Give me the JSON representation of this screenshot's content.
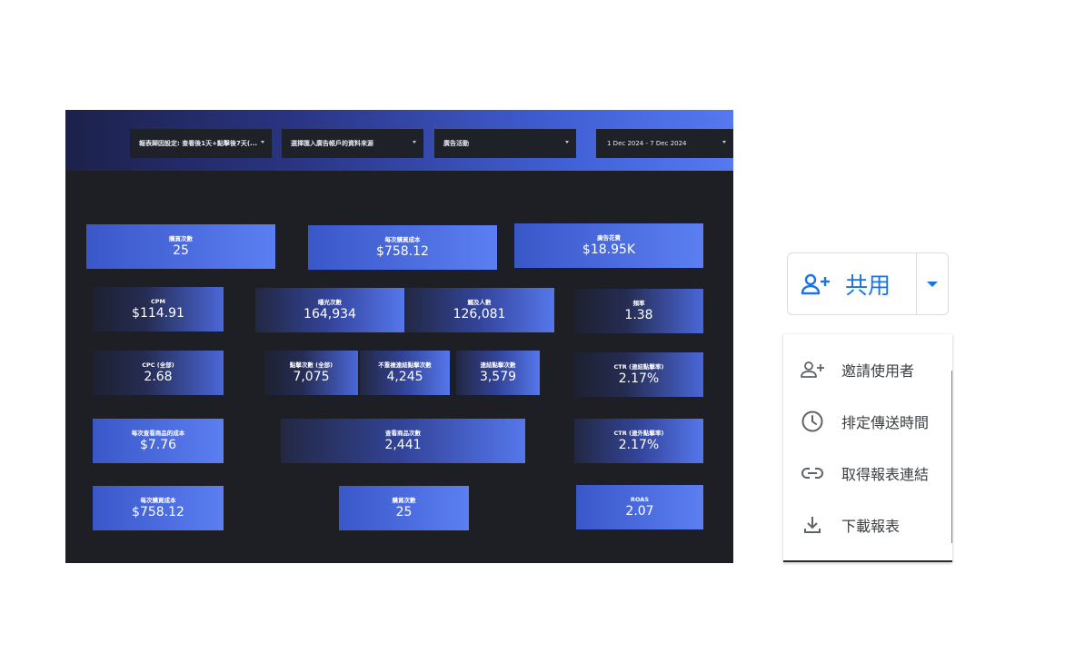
{
  "filters": {
    "report_setting": "報表歸因設定: 查看後1天+點擊後7天(...",
    "data_source": "選擇匯入廣告帳戶的資料來源",
    "campaign": "廣告活動",
    "date_range": "1 Dec 2024 - 7 Dec 2024"
  },
  "cards": {
    "purchases": {
      "label": "購買次數",
      "value": "25"
    },
    "cost_per_purchase": {
      "label": "每次購買成本",
      "value": "$758.12"
    },
    "ad_spend": {
      "label": "廣告花費",
      "value": "$18.95K"
    },
    "cpm": {
      "label": "CPM",
      "value": "$114.91"
    },
    "impressions": {
      "label": "曝光次數",
      "value": "164,934"
    },
    "reach": {
      "label": "觸及人數",
      "value": "126,081"
    },
    "frequency": {
      "label": "頻率",
      "value": "1.38"
    },
    "cpc_all": {
      "label": "CPC (全部)",
      "value": "2.68"
    },
    "clicks_all": {
      "label": "點擊次數 (全部)",
      "value": "7,075"
    },
    "unique_link_clicks": {
      "label": "不重複連結點擊次數",
      "value": "4,245"
    },
    "link_clicks": {
      "label": "連結點擊次數",
      "value": "3,579"
    },
    "ctr_link": {
      "label": "CTR (連結點擊率)",
      "value": "2.17%"
    },
    "cost_per_view_content": {
      "label": "每次查看商品的成本",
      "value": "$7.76"
    },
    "view_content": {
      "label": "查看商品次數",
      "value": "2,441"
    },
    "ctr_outbound": {
      "label": "CTR (連外點擊率)",
      "value": "2.17%"
    },
    "cost_per_purchase_2": {
      "label": "每次購買成本",
      "value": "$758.12"
    },
    "purchases_2": {
      "label": "購買次數",
      "value": "25"
    },
    "roas": {
      "label": "ROAS",
      "value": "2.07"
    }
  },
  "share": {
    "label": "共用",
    "icon": "person-add-icon",
    "dropdown_icon": "caret-down-icon",
    "accent": "#1a73e8"
  },
  "menu": {
    "items": [
      {
        "label": "邀請使用者",
        "icon": "person-add-icon"
      },
      {
        "label": "排定傳送時間",
        "icon": "clock-icon"
      },
      {
        "label": "取得報表連結",
        "icon": "link-icon"
      },
      {
        "label": "下載報表",
        "icon": "download-icon"
      }
    ]
  }
}
